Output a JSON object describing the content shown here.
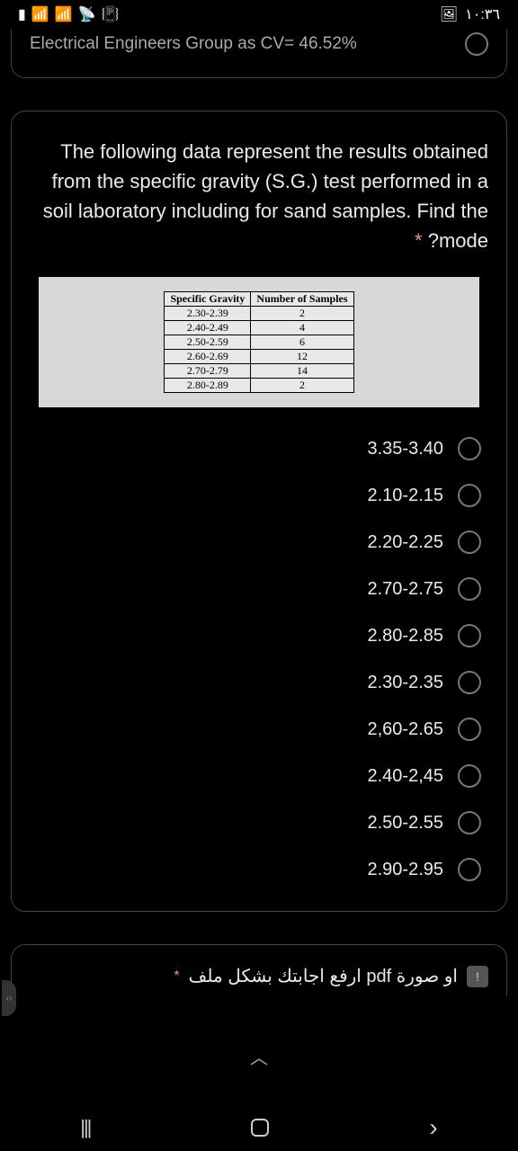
{
  "status": {
    "time": "١٠:٣٦",
    "icons": "▮ ║ ║ ⦿ ⟐"
  },
  "top_card": {
    "text": "Electrical Engineers Group as CV= 46.52%"
  },
  "question": {
    "text": "The following data represent the results obtained from the specific gravity (S.G.) test performed in a soil laboratory including for sand samples. Find the mode?",
    "required": "*"
  },
  "table": {
    "h1": "Specific Gravity",
    "h2": "Number of Samples",
    "rows": [
      {
        "sg": "2.30-2.39",
        "n": "2"
      },
      {
        "sg": "2.40-2.49",
        "n": "4"
      },
      {
        "sg": "2.50-2.59",
        "n": "6"
      },
      {
        "sg": "2.60-2.69",
        "n": "12"
      },
      {
        "sg": "2.70-2.79",
        "n": "14"
      },
      {
        "sg": "2.80-2.89",
        "n": "2"
      }
    ]
  },
  "options": [
    "3.35-3.40",
    "2.10-2.15",
    "2.20-2.25",
    "2.70-2.75",
    "2.80-2.85",
    "2.30-2.35",
    "2,60-2.65",
    "2.40-2,45",
    "2.50-2.55",
    "2.90-2.95"
  ],
  "upload": {
    "text": "ارفع اجابتك بشكل ملف pdf او صورة",
    "required": "*"
  }
}
